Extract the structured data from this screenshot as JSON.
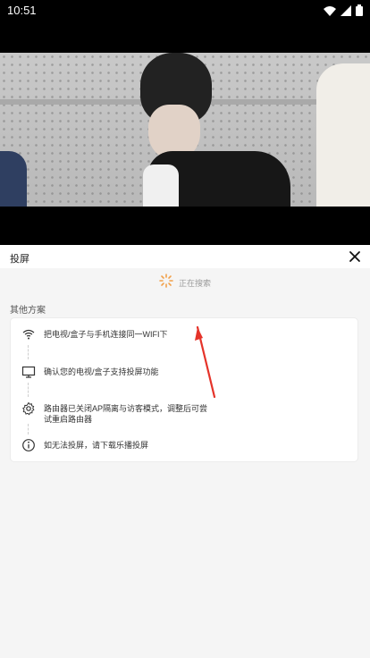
{
  "status_bar": {
    "time": "10:51"
  },
  "sheet": {
    "title": "投屏",
    "searching_text": "正在搜索",
    "section_title": "其他方案",
    "steps": [
      {
        "icon": "wifi-icon",
        "text": "把电视/盒子与手机连接同一WIFI下"
      },
      {
        "icon": "monitor-icon",
        "text": "确认您的电视/盒子支持投屏功能"
      },
      {
        "icon": "settings-icon",
        "text": "路由器已关闭AP隔离与访客模式，调整后可尝试重启路由器"
      },
      {
        "icon": "info-icon",
        "text": "如无法投屏，请下载乐播投屏"
      }
    ]
  }
}
